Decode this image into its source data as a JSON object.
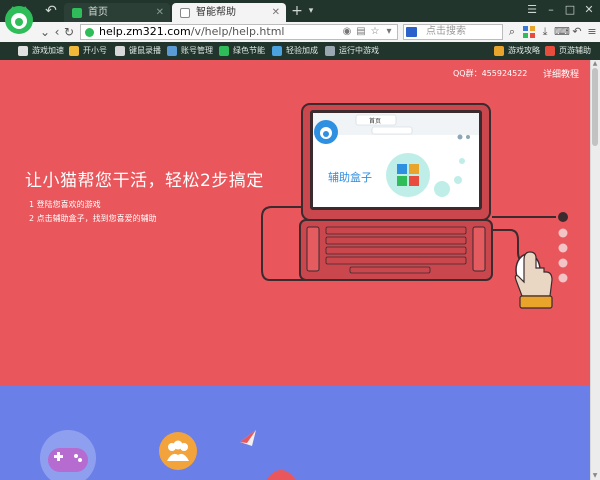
{
  "browser": {
    "tabs": [
      {
        "label": "首页",
        "active": false
      },
      {
        "label": "智能帮助",
        "active": true
      }
    ],
    "url": {
      "host": "help.zm321.com",
      "path": "/v/help/help.html"
    },
    "search_placeholder": "点击搜索",
    "window_controls": [
      "menu-icon",
      "minimize-icon",
      "maximize-icon",
      "close-icon"
    ]
  },
  "bookmarks": [
    {
      "label": "游戏加速",
      "icon": "rocket-icon"
    },
    {
      "label": "开小号",
      "icon": "user-add-icon"
    },
    {
      "label": "键鼠录播",
      "icon": "keyboard-icon"
    },
    {
      "label": "账号管理",
      "icon": "account-icon"
    },
    {
      "label": "绿色节能",
      "icon": "leaf-icon"
    },
    {
      "label": "轻验加成",
      "icon": "gift-icon"
    },
    {
      "label": "运行中游戏",
      "icon": "gamepad-icon"
    },
    {
      "label": "游戏攻略",
      "icon": "book-icon"
    },
    {
      "label": "页游辅助",
      "icon": "tools-icon"
    }
  ],
  "page": {
    "qq_group": "QQ群：455924522",
    "guide_link": "详细教程",
    "hero_title": "让小猫帮您干活，轻松2步搞定",
    "steps": [
      "1 登陆您喜欢的游戏",
      "2 点击辅助盒子，找到您喜爱的辅助"
    ],
    "illustration": {
      "mini_tab": "首页",
      "box_label": "辅助盒子"
    }
  },
  "colors": {
    "hero_bg": "#e9575c",
    "second_section_bg": "#6b7fe8",
    "chrome_dark": "#22352d",
    "brand_green": "#2ebd59"
  }
}
